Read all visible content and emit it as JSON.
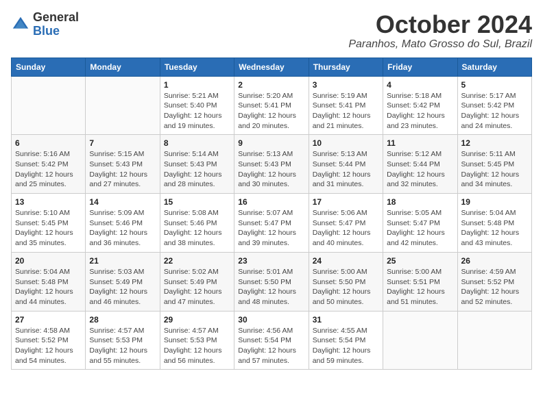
{
  "header": {
    "logo_line1": "General",
    "logo_line2": "Blue",
    "month": "October 2024",
    "location": "Paranhos, Mato Grosso do Sul, Brazil"
  },
  "days_of_week": [
    "Sunday",
    "Monday",
    "Tuesday",
    "Wednesday",
    "Thursday",
    "Friday",
    "Saturday"
  ],
  "weeks": [
    [
      {
        "day": "",
        "info": ""
      },
      {
        "day": "",
        "info": ""
      },
      {
        "day": "1",
        "info": "Sunrise: 5:21 AM\nSunset: 5:40 PM\nDaylight: 12 hours\nand 19 minutes."
      },
      {
        "day": "2",
        "info": "Sunrise: 5:20 AM\nSunset: 5:41 PM\nDaylight: 12 hours\nand 20 minutes."
      },
      {
        "day": "3",
        "info": "Sunrise: 5:19 AM\nSunset: 5:41 PM\nDaylight: 12 hours\nand 21 minutes."
      },
      {
        "day": "4",
        "info": "Sunrise: 5:18 AM\nSunset: 5:42 PM\nDaylight: 12 hours\nand 23 minutes."
      },
      {
        "day": "5",
        "info": "Sunrise: 5:17 AM\nSunset: 5:42 PM\nDaylight: 12 hours\nand 24 minutes."
      }
    ],
    [
      {
        "day": "6",
        "info": "Sunrise: 5:16 AM\nSunset: 5:42 PM\nDaylight: 12 hours\nand 25 minutes."
      },
      {
        "day": "7",
        "info": "Sunrise: 5:15 AM\nSunset: 5:43 PM\nDaylight: 12 hours\nand 27 minutes."
      },
      {
        "day": "8",
        "info": "Sunrise: 5:14 AM\nSunset: 5:43 PM\nDaylight: 12 hours\nand 28 minutes."
      },
      {
        "day": "9",
        "info": "Sunrise: 5:13 AM\nSunset: 5:43 PM\nDaylight: 12 hours\nand 30 minutes."
      },
      {
        "day": "10",
        "info": "Sunrise: 5:13 AM\nSunset: 5:44 PM\nDaylight: 12 hours\nand 31 minutes."
      },
      {
        "day": "11",
        "info": "Sunrise: 5:12 AM\nSunset: 5:44 PM\nDaylight: 12 hours\nand 32 minutes."
      },
      {
        "day": "12",
        "info": "Sunrise: 5:11 AM\nSunset: 5:45 PM\nDaylight: 12 hours\nand 34 minutes."
      }
    ],
    [
      {
        "day": "13",
        "info": "Sunrise: 5:10 AM\nSunset: 5:45 PM\nDaylight: 12 hours\nand 35 minutes."
      },
      {
        "day": "14",
        "info": "Sunrise: 5:09 AM\nSunset: 5:46 PM\nDaylight: 12 hours\nand 36 minutes."
      },
      {
        "day": "15",
        "info": "Sunrise: 5:08 AM\nSunset: 5:46 PM\nDaylight: 12 hours\nand 38 minutes."
      },
      {
        "day": "16",
        "info": "Sunrise: 5:07 AM\nSunset: 5:47 PM\nDaylight: 12 hours\nand 39 minutes."
      },
      {
        "day": "17",
        "info": "Sunrise: 5:06 AM\nSunset: 5:47 PM\nDaylight: 12 hours\nand 40 minutes."
      },
      {
        "day": "18",
        "info": "Sunrise: 5:05 AM\nSunset: 5:47 PM\nDaylight: 12 hours\nand 42 minutes."
      },
      {
        "day": "19",
        "info": "Sunrise: 5:04 AM\nSunset: 5:48 PM\nDaylight: 12 hours\nand 43 minutes."
      }
    ],
    [
      {
        "day": "20",
        "info": "Sunrise: 5:04 AM\nSunset: 5:48 PM\nDaylight: 12 hours\nand 44 minutes."
      },
      {
        "day": "21",
        "info": "Sunrise: 5:03 AM\nSunset: 5:49 PM\nDaylight: 12 hours\nand 46 minutes."
      },
      {
        "day": "22",
        "info": "Sunrise: 5:02 AM\nSunset: 5:49 PM\nDaylight: 12 hours\nand 47 minutes."
      },
      {
        "day": "23",
        "info": "Sunrise: 5:01 AM\nSunset: 5:50 PM\nDaylight: 12 hours\nand 48 minutes."
      },
      {
        "day": "24",
        "info": "Sunrise: 5:00 AM\nSunset: 5:50 PM\nDaylight: 12 hours\nand 50 minutes."
      },
      {
        "day": "25",
        "info": "Sunrise: 5:00 AM\nSunset: 5:51 PM\nDaylight: 12 hours\nand 51 minutes."
      },
      {
        "day": "26",
        "info": "Sunrise: 4:59 AM\nSunset: 5:52 PM\nDaylight: 12 hours\nand 52 minutes."
      }
    ],
    [
      {
        "day": "27",
        "info": "Sunrise: 4:58 AM\nSunset: 5:52 PM\nDaylight: 12 hours\nand 54 minutes."
      },
      {
        "day": "28",
        "info": "Sunrise: 4:57 AM\nSunset: 5:53 PM\nDaylight: 12 hours\nand 55 minutes."
      },
      {
        "day": "29",
        "info": "Sunrise: 4:57 AM\nSunset: 5:53 PM\nDaylight: 12 hours\nand 56 minutes."
      },
      {
        "day": "30",
        "info": "Sunrise: 4:56 AM\nSunset: 5:54 PM\nDaylight: 12 hours\nand 57 minutes."
      },
      {
        "day": "31",
        "info": "Sunrise: 4:55 AM\nSunset: 5:54 PM\nDaylight: 12 hours\nand 59 minutes."
      },
      {
        "day": "",
        "info": ""
      },
      {
        "day": "",
        "info": ""
      }
    ]
  ]
}
